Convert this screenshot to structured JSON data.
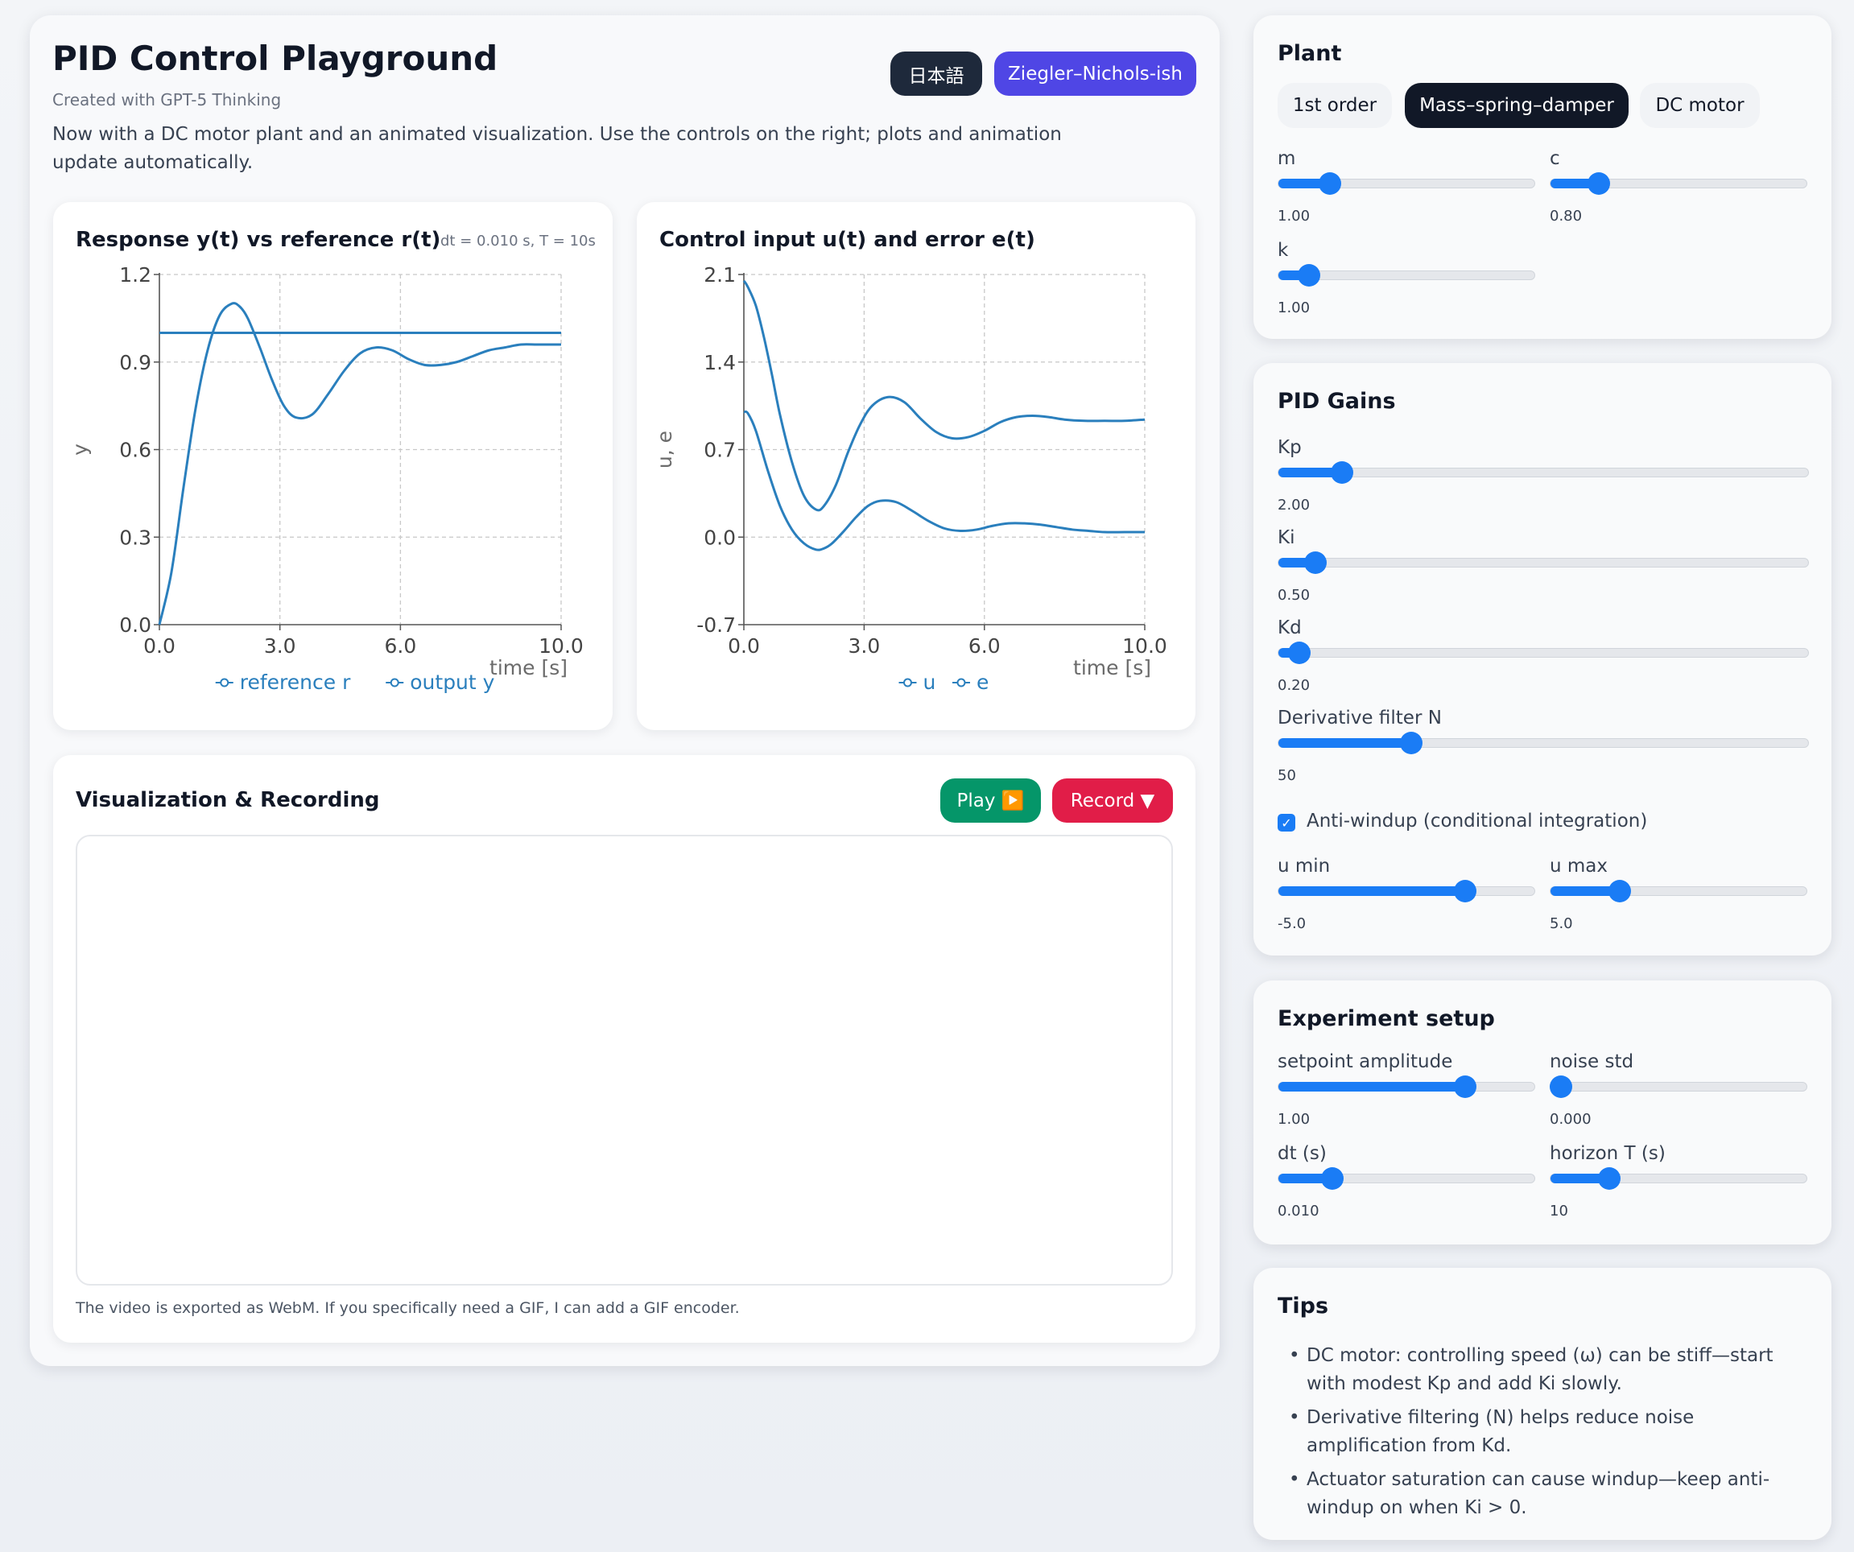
{
  "header": {
    "title": "PID Control Playground",
    "subtitle": "Created with GPT-5 Thinking",
    "description": "Now with a DC motor plant and an animated visualization. Use the controls on the right; plots and animation update automatically.",
    "lang_button": "日本語",
    "preset_button": "Ziegler–Nichols-ish"
  },
  "chart1": {
    "title": "Response y(t) vs reference r(t)",
    "meta": "dt = 0.010 s, T = 10s"
  },
  "chart2": {
    "title": "Control input u(t) and error e(t)"
  },
  "chart_data": [
    {
      "type": "line",
      "title": "",
      "xlabel": "time [s]",
      "ylabel": "y",
      "xlim": [
        0,
        10
      ],
      "ylim": [
        0,
        1.2
      ],
      "xticks": [
        "0.0",
        "3.0",
        "6.0",
        "10.0"
      ],
      "xtick_values": [
        0,
        3,
        6,
        10
      ],
      "yticks": [
        "0.0",
        "0.3",
        "0.6",
        "0.9",
        "1.2"
      ],
      "ytick_values": [
        0,
        0.3,
        0.6,
        0.9,
        1.2
      ],
      "grid": true,
      "legend": "bottom",
      "color": "#2a7fbd",
      "series": [
        {
          "name": "reference r",
          "x": [
            0,
            10
          ],
          "y": [
            1.0,
            1.0
          ]
        },
        {
          "name": "output y",
          "x": [
            0,
            0.3,
            0.6,
            0.9,
            1.2,
            1.5,
            1.8,
            2.0,
            2.2,
            2.5,
            2.8,
            3.1,
            3.4,
            3.8,
            4.2,
            4.6,
            5.0,
            5.4,
            5.8,
            6.2,
            6.6,
            7.0,
            7.4,
            7.8,
            8.2,
            8.6,
            9.0,
            9.4,
            9.8,
            10.0
          ],
          "y": [
            0,
            0.18,
            0.47,
            0.74,
            0.94,
            1.06,
            1.1,
            1.09,
            1.05,
            0.95,
            0.84,
            0.75,
            0.71,
            0.72,
            0.79,
            0.87,
            0.93,
            0.95,
            0.94,
            0.91,
            0.89,
            0.89,
            0.9,
            0.92,
            0.94,
            0.95,
            0.96,
            0.96,
            0.96,
            0.96
          ]
        }
      ]
    },
    {
      "type": "line",
      "title": "",
      "xlabel": "time [s]",
      "ylabel": "u, e",
      "xlim": [
        0,
        10
      ],
      "ylim": [
        -0.7,
        2.1
      ],
      "xticks": [
        "0.0",
        "3.0",
        "6.0",
        "10.0"
      ],
      "xtick_values": [
        0,
        3,
        6,
        10
      ],
      "yticks": [
        "-0.7",
        "0.0",
        "0.7",
        "1.4",
        "2.1"
      ],
      "ytick_values": [
        -0.7,
        0,
        0.7,
        1.4,
        2.1
      ],
      "grid": true,
      "legend": "bottom",
      "color": "#2a7fbd",
      "series": [
        {
          "name": "u",
          "x": [
            0,
            0.1,
            0.3,
            0.5,
            0.7,
            0.9,
            1.2,
            1.5,
            1.8,
            2.0,
            2.3,
            2.6,
            2.9,
            3.2,
            3.6,
            4.0,
            4.4,
            4.8,
            5.2,
            5.6,
            6.0,
            6.4,
            6.8,
            7.2,
            7.6,
            8.0,
            8.5,
            9.0,
            9.5,
            10.0
          ],
          "y": [
            2.05,
            2.0,
            1.85,
            1.6,
            1.3,
            0.98,
            0.6,
            0.33,
            0.22,
            0.25,
            0.42,
            0.68,
            0.9,
            1.05,
            1.12,
            1.08,
            0.95,
            0.84,
            0.79,
            0.8,
            0.85,
            0.92,
            0.96,
            0.97,
            0.96,
            0.94,
            0.93,
            0.93,
            0.93,
            0.94
          ]
        },
        {
          "name": "e",
          "x": [
            0,
            0.1,
            0.3,
            0.6,
            0.9,
            1.2,
            1.5,
            1.8,
            2.0,
            2.2,
            2.5,
            2.8,
            3.1,
            3.4,
            3.8,
            4.2,
            4.6,
            5.0,
            5.4,
            5.8,
            6.2,
            6.6,
            7.0,
            7.4,
            7.8,
            8.2,
            8.6,
            9.0,
            9.5,
            10.0
          ],
          "y": [
            1.0,
            0.99,
            0.85,
            0.53,
            0.25,
            0.06,
            -0.05,
            -0.1,
            -0.09,
            -0.05,
            0.05,
            0.16,
            0.25,
            0.29,
            0.28,
            0.21,
            0.13,
            0.07,
            0.05,
            0.06,
            0.09,
            0.11,
            0.11,
            0.1,
            0.08,
            0.06,
            0.05,
            0.04,
            0.04,
            0.04
          ]
        }
      ]
    }
  ],
  "viz": {
    "title": "Visualization & Recording",
    "play": "Play ▶️",
    "record": "Record ▼",
    "note": "The video is exported as WebM. If you specifically need a GIF, I can add a GIF encoder."
  },
  "plant": {
    "title": "Plant",
    "options": [
      "1st order",
      "Mass–spring–damper",
      "DC motor"
    ],
    "selected": "Mass–spring–damper",
    "params": [
      {
        "label": "m",
        "value": "1.00",
        "level": 0.2
      },
      {
        "label": "c",
        "value": "0.80",
        "level": 0.19
      },
      {
        "label": "k",
        "value": "1.00",
        "level": 0.12
      }
    ]
  },
  "pid": {
    "title": "PID Gains",
    "params": [
      {
        "label": "Kp",
        "value": "2.00",
        "level": 0.12
      },
      {
        "label": "Ki",
        "value": "0.50",
        "level": 0.07
      },
      {
        "label": "Kd",
        "value": "0.20",
        "level": 0.04
      },
      {
        "label": "Derivative filter N",
        "value": "50",
        "level": 0.25
      }
    ],
    "antiwindup_label": "Anti-windup (conditional integration)",
    "antiwindup_checked": true,
    "limits": [
      {
        "label": "u min",
        "value": "-5.0",
        "level": 0.73
      },
      {
        "label": "u max",
        "value": "5.0",
        "level": 0.27
      }
    ]
  },
  "experiment": {
    "title": "Experiment setup",
    "params": [
      {
        "label": "setpoint amplitude",
        "value": "1.00",
        "level": 0.73
      },
      {
        "label": "noise std",
        "value": "0.000",
        "level": 0.04
      },
      {
        "label": "dt (s)",
        "value": "0.010",
        "level": 0.21
      },
      {
        "label": "horizon T (s)",
        "value": "10",
        "level": 0.23
      }
    ]
  },
  "tips": {
    "title": "Tips",
    "items": [
      "DC motor: controlling speed (ω) can be stiff—start with modest Kp and add Ki slowly.",
      "Derivative filtering (N) helps reduce noise amplification from Kd.",
      "Actuator saturation can cause windup—keep anti-windup on when Ki > 0."
    ]
  }
}
